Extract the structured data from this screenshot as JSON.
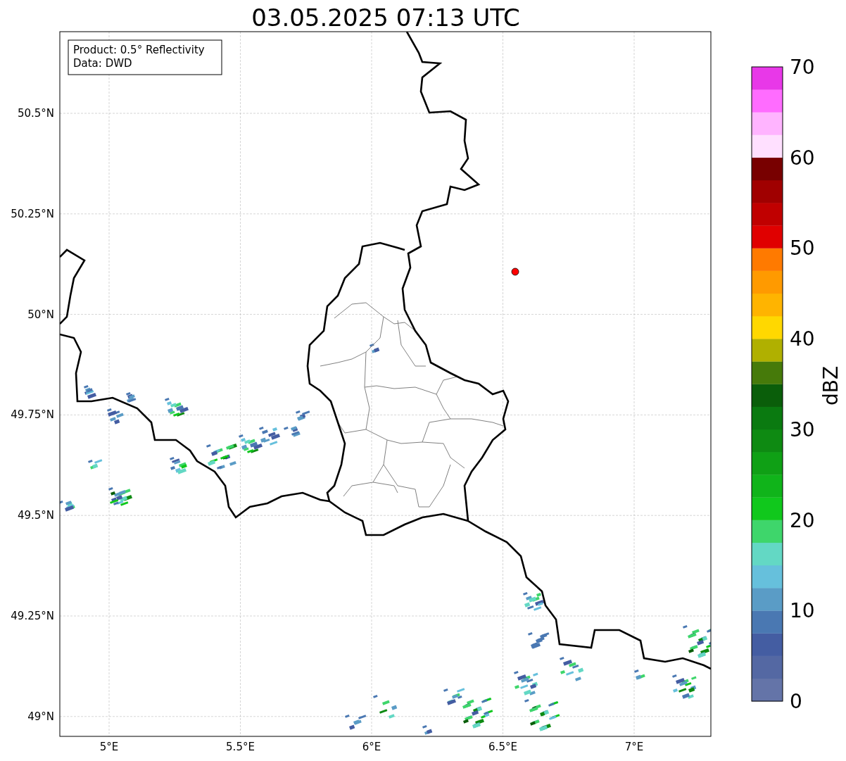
{
  "title": "03.05.2025 07:13 UTC",
  "info_box": {
    "lines": [
      "Product: 0.5° Reflectivity",
      "Data: DWD"
    ]
  },
  "map": {
    "lat_ticks": [
      "50.5°N",
      "50.25°N",
      "50°N",
      "49.75°N",
      "49.5°N",
      "49.25°N",
      "49°N"
    ],
    "lon_ticks": [
      "5°E",
      "5.5°E",
      "6°E",
      "6.5°E",
      "7°E"
    ]
  },
  "colorbar": {
    "label": "dBZ",
    "ticks": [
      "70",
      "60",
      "50",
      "40",
      "30",
      "20",
      "10",
      "0"
    ]
  }
}
